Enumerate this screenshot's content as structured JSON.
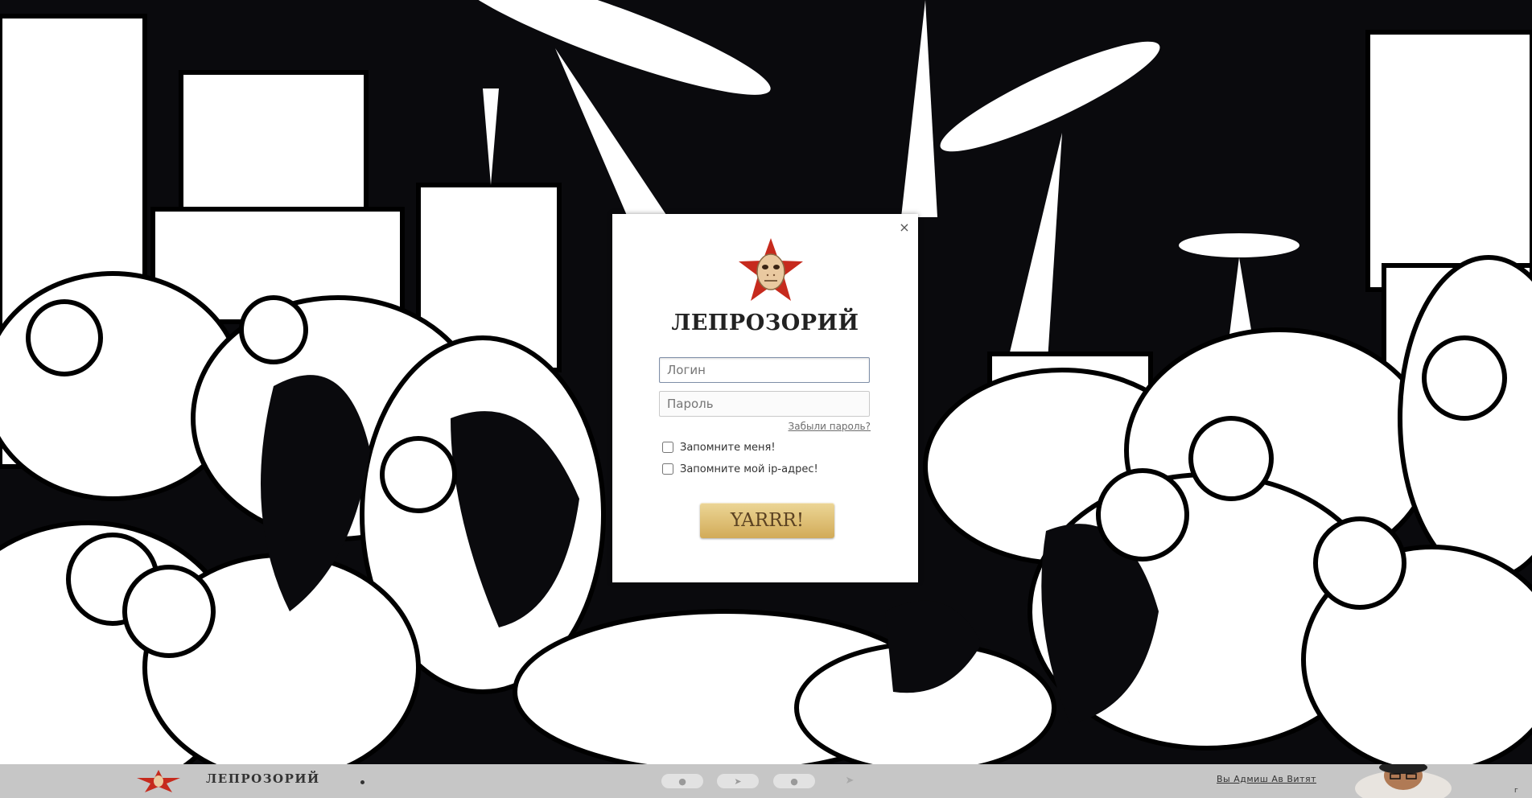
{
  "site": {
    "brand": "ЛЕПРОЗОРИЙ"
  },
  "login_form": {
    "close_glyph": "×",
    "login_placeholder": "Логин",
    "password_placeholder": "Пароль",
    "forgot_label": "Забыли пароль?",
    "remember_me_label": "Запомните меня!",
    "remember_ip_label": "Запомните мой ip-адрес!",
    "submit_label": "YARRR!"
  },
  "footer": {
    "brand": "ЛЕПРОЗОРИЙ",
    "social_icons": [
      "twitter-icon",
      "telegram-icon",
      "apple-icon",
      "paper-plane-icon"
    ],
    "right_link": "Вы Адмиш Ав Витят",
    "mini_text": "г"
  },
  "colors": {
    "background": "#0a0a0d",
    "footer": "#c6c6c6",
    "submit_button": "#dfbd70",
    "logo_star": "#c62a1d"
  }
}
